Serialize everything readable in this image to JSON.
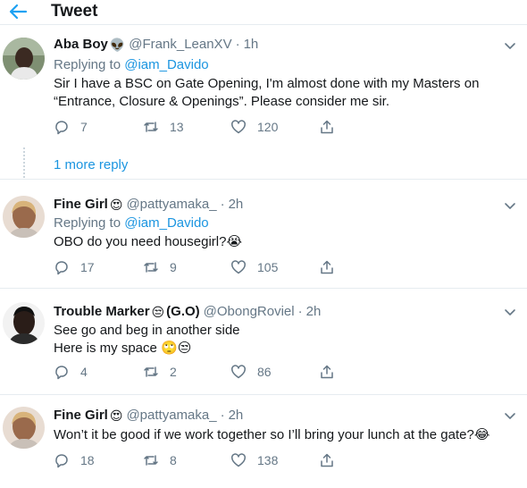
{
  "header": {
    "title": "Tweet",
    "back_icon": "arrow-left-icon",
    "accent": "#1da1f2"
  },
  "colors": {
    "link": "#1b95e0",
    "secondary": "#657786",
    "divider": "#e6ecf0"
  },
  "tweets": [
    {
      "name": "Aba Boy",
      "emoji": "👽",
      "handle": "@Frank_LeanXV",
      "dot": "·",
      "time": "1h",
      "reply_prefix": "Replying to ",
      "reply_to": "@iam_Davido",
      "lines": [
        "Sir I have a BSC on Gate Opening, I'm almost done with my Masters on",
        "“Entrance, Closure & Openings”. Please consider me sir."
      ],
      "replies": "7",
      "retweets": "13",
      "likes": "120",
      "more_reply": "1 more reply"
    },
    {
      "name": "Fine Girl",
      "emoji": "😍",
      "handle": "@pattyamaka_",
      "dot": "·",
      "time": "2h",
      "reply_prefix": "Replying to ",
      "reply_to": "@iam_Davido",
      "lines": [
        "OBO do you need housegirl?😭"
      ],
      "replies": "17",
      "retweets": "9",
      "likes": "105"
    },
    {
      "name": "Trouble Marker ",
      "emoji": "😒",
      "name_suffix": "(G.O)",
      "handle": "@ObongRoviel",
      "dot": "·",
      "time": "2h",
      "lines": [
        "See go and beg in another side",
        "Here is my space 🙄😒"
      ],
      "replies": "4",
      "retweets": "2",
      "likes": "86"
    },
    {
      "name": "Fine Girl",
      "emoji": "😍",
      "handle": "@pattyamaka_",
      "dot": "·",
      "time": "2h",
      "lines": [
        "Won’t it be good if we work together so I’ll bring your lunch at the gate?😂"
      ],
      "replies": "18",
      "retweets": "8",
      "likes": "138"
    }
  ]
}
